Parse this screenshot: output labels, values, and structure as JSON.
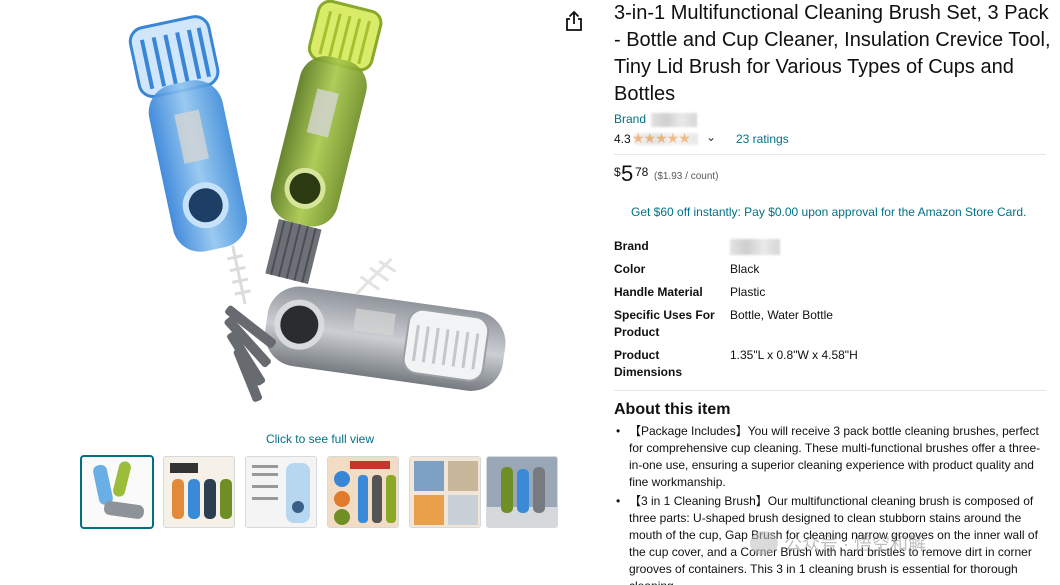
{
  "left": {
    "click_full": "Click to see full view"
  },
  "icons": {
    "share": "share-icon"
  },
  "product": {
    "title": "3-in-1 Multifunctional Cleaning Brush Set, 3 Pack - Bottle and Cup Cleaner, Insulation Crevice Tool, Tiny Lid Brush for Various Types of Cups and Bottles",
    "brand_prefix": "Brand",
    "rating_value": "4.3",
    "stars": "★★★★★",
    "ratings_count": "23 ratings",
    "price_symbol": "$",
    "price_whole": "5",
    "price_fraction": "78",
    "price_per_unit": "($1.93 / count)",
    "promo": "Get $60 off instantly: Pay $0.00 upon approval for the Amazon Store Card."
  },
  "specs": [
    {
      "key": "Brand",
      "value": ""
    },
    {
      "key": "Color",
      "value": "Black"
    },
    {
      "key": "Handle Material",
      "value": "Plastic"
    },
    {
      "key": "Specific Uses For Product",
      "value": "Bottle, Water Bottle"
    },
    {
      "key": "Product Dimensions",
      "value": "1.35\"L x 0.8\"W x 4.58\"H"
    }
  ],
  "about": {
    "title": "About this item",
    "bullets": [
      "【Package Includes】You will receive 3 pack bottle cleaning brushes, perfect for comprehensive cup cleaning. These multi-functional brushes offer a three-in-one use, ensuring a superior cleaning experience with product quality and fine workmanship.",
      "【3 in 1 Cleaning Brush】Our multifunctional cleaning brush is composed of three parts: U-shaped brush designed to clean stubborn stains around the mouth of the cup, Gap Brush for cleaning narrow grooves on the inner wall of the cup cover, and a Corner Brush with hard bristles to remove dirt in corner grooves of containers. This 3 in 1 cleaning brush is essential for thorough cleaning."
    ]
  },
  "watermark": {
    "text": "公众号 · 悟空和解"
  },
  "colors": {
    "link": "#007185",
    "star": "#ff8b1a",
    "text": "#0f1111"
  }
}
